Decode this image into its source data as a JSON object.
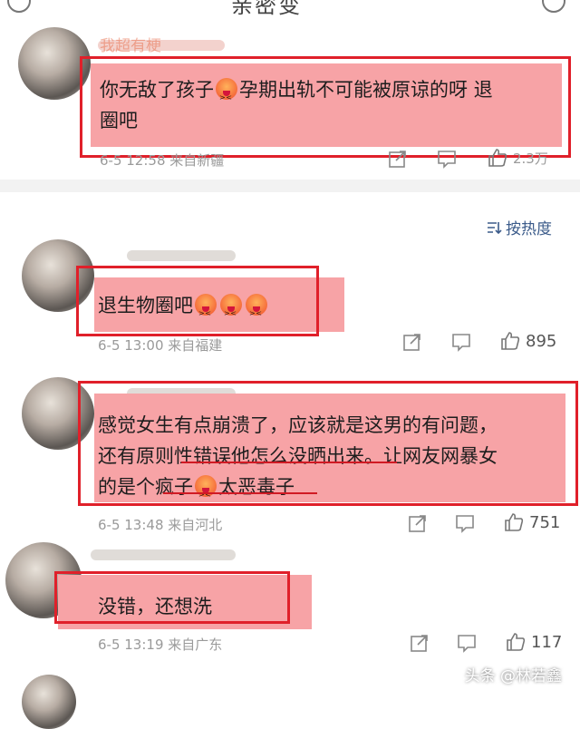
{
  "header": {
    "title": "亲密变"
  },
  "comments": [
    {
      "username": "我超有梗",
      "text_line1": "你无敌了孩子",
      "text_line1b": "孕期出轨不可能被原谅的呀 退",
      "text_line2": "圈吧",
      "time": "6-5 12:58",
      "source": "来自新疆",
      "likes": "2.3万"
    },
    {
      "username": "",
      "text": "退生物圈吧",
      "time": "6-5 13:00",
      "source": "来自福建",
      "likes": "895"
    },
    {
      "username": "",
      "text_line1": "感觉女生有点崩溃了，应该就是这男的有问题，",
      "text_line2": "还有原则性错误他怎么没晒出来。让网友网暴女",
      "text_line3a": "的是个疯子",
      "text_line3b": "太恶毒子",
      "time": "6-5 13:48",
      "source": "来自河北",
      "likes": "751"
    },
    {
      "username": "",
      "text": "没错，还想洗",
      "time": "6-5 13:19",
      "source": "来自广东",
      "likes": "117"
    }
  ],
  "sort": {
    "label": "按热度"
  },
  "watermark": "头条 @林若鑫",
  "colors": {
    "highlight": "#f7a3a6",
    "box": "#e0202a",
    "meta": "#9a9a9a",
    "sort": "#3b5b8a"
  }
}
